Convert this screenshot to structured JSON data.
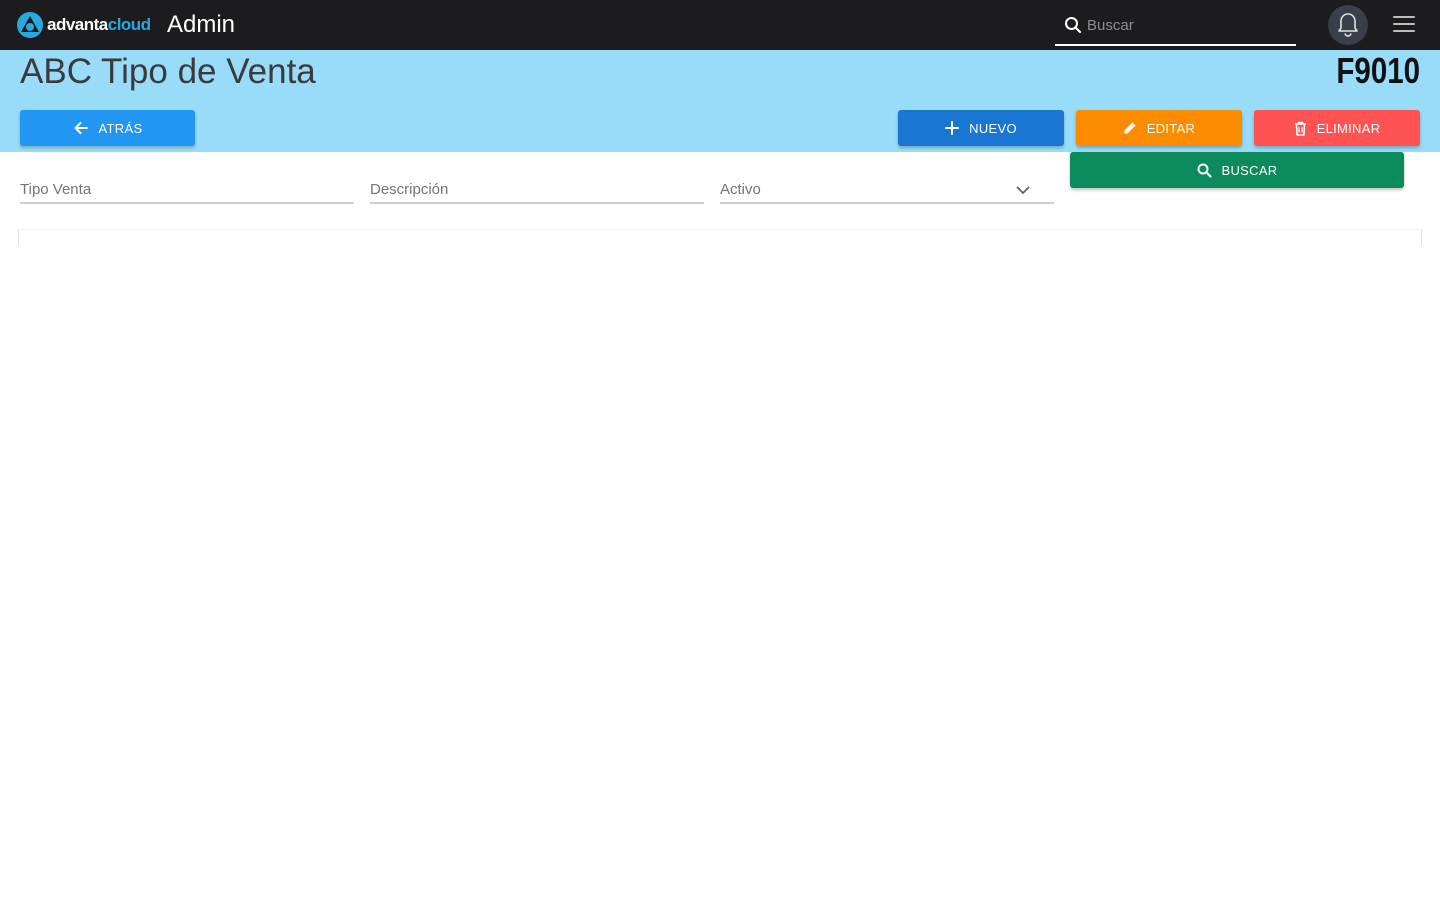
{
  "app": {
    "logo_part1": "advanta",
    "logo_part2": "cloud",
    "title": "Admin"
  },
  "topbar": {
    "search_placeholder": "Buscar",
    "icons": [
      "search-icon",
      "bell-icon",
      "hamburger-menu-icon"
    ]
  },
  "header": {
    "title": "ABC Tipo de Venta",
    "code": "F9010"
  },
  "actions": {
    "back": "ATRÁS",
    "new": "NUEVO",
    "edit": "EDITAR",
    "delete": "ELIMINAR",
    "search": "BUSCAR"
  },
  "filters": {
    "tipo_venta": "Tipo Venta",
    "descripcion": "Descripción",
    "activo": "Activo"
  },
  "colors": {
    "topbar": "#1c1c1e",
    "band": "#99dcf9",
    "back": "#2196f3",
    "new": "#1976d2",
    "edit": "#fb8c00",
    "delete": "#ff5252",
    "search": "#0b8a5b"
  }
}
